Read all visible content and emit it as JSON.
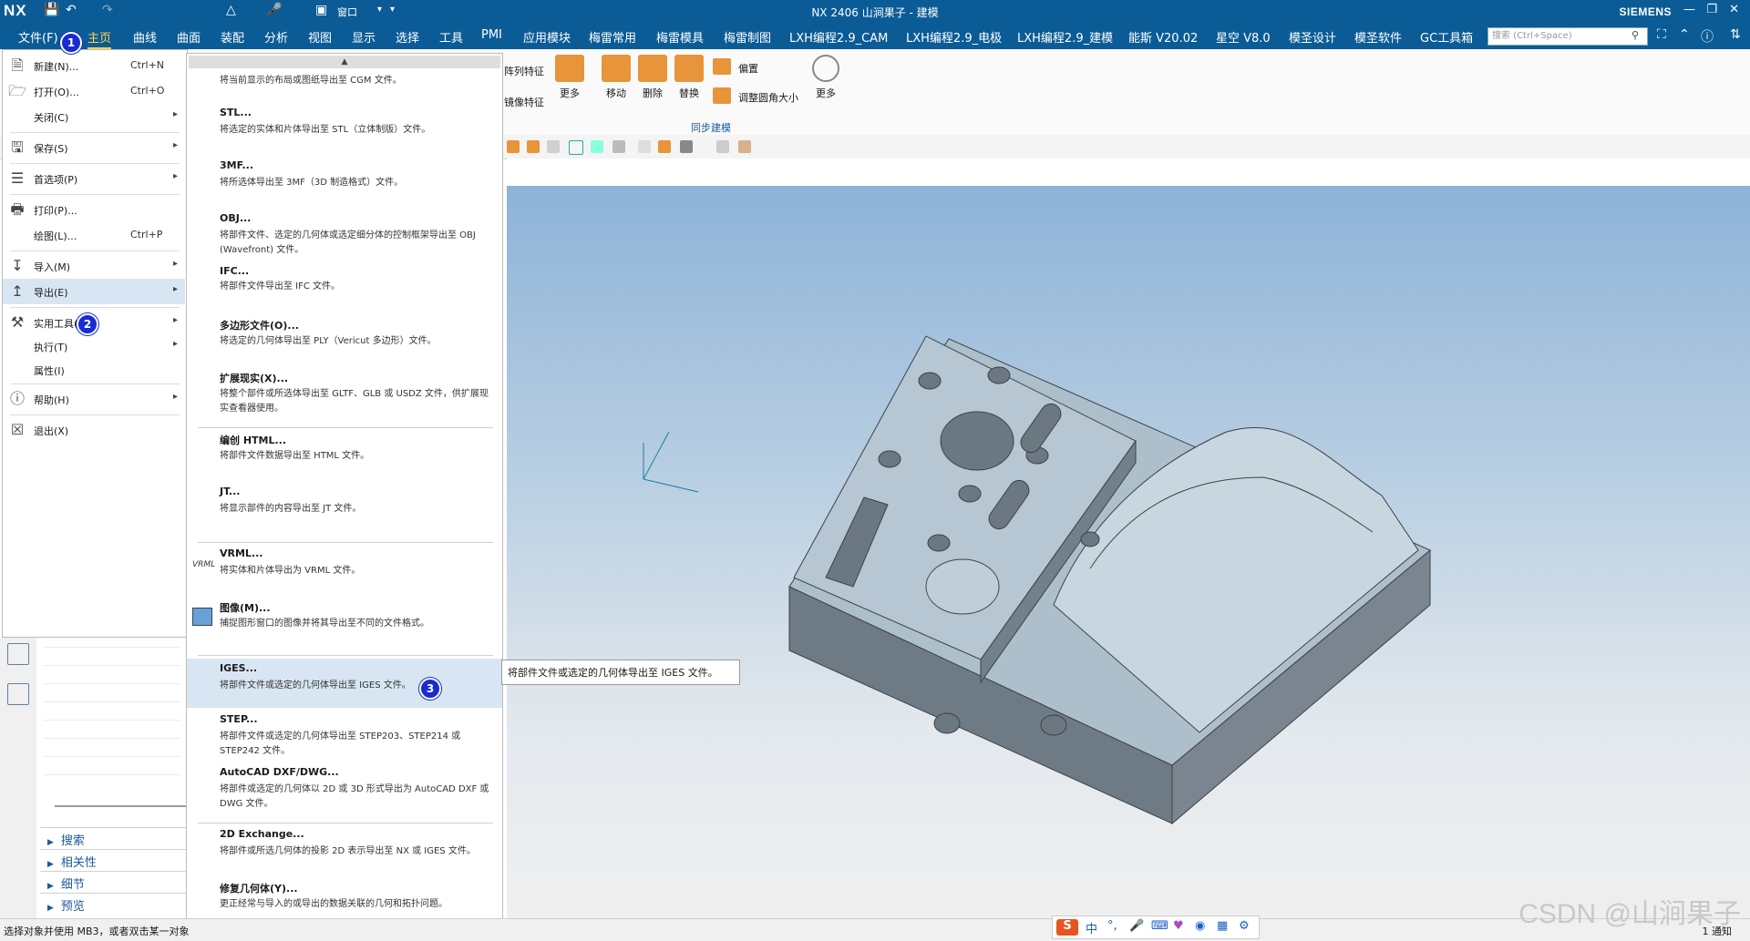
{
  "app": {
    "logo": "NX",
    "title": "NX 2406 山涧果子 - 建模",
    "brand": "SIEMENS",
    "window_menu": "窗口",
    "accent": "#0b5c96"
  },
  "tabs": [
    "文件(F)",
    "主页",
    "曲线",
    "曲面",
    "装配",
    "分析",
    "视图",
    "显示",
    "选择",
    "工具",
    "PMI",
    "应用模块",
    "梅雷常用",
    "梅雷模具",
    "梅雷制图",
    "LXH编程2.9_CAM",
    "LXH编程2.9_电极",
    "LXH编程2.9_建模",
    "能斯 V20.02",
    "星空 V8.0",
    "模圣设计",
    "模圣软件",
    "GC工具箱"
  ],
  "search": {
    "placeholder": "搜索 (Ctrl+Space)"
  },
  "ribbon": {
    "partial_top": "阵列特征",
    "partial_bottom": "镜像特征",
    "more1": "更多",
    "move": "移动",
    "delete": "删除",
    "replace": "替换",
    "offset": "偏置",
    "resize_blend": "调整圆角大小",
    "more2": "更多",
    "group_sync": "同步建模"
  },
  "file_menu": {
    "items": [
      {
        "label": "新建(N)...",
        "shortcut": "Ctrl+N",
        "icon": "new-file-icon"
      },
      {
        "label": "打开(O)...",
        "shortcut": "Ctrl+O",
        "icon": "open-folder-icon"
      },
      {
        "label": "关闭(C)",
        "arrow": true
      },
      {
        "label": "保存(S)",
        "arrow": true,
        "icon": "save-icon"
      },
      {
        "label": "首选项(P)",
        "arrow": true,
        "icon": "preferences-icon"
      },
      {
        "label": "打印(P)...",
        "icon": "print-icon"
      },
      {
        "label": "绘图(L)...",
        "shortcut": "Ctrl+P"
      },
      {
        "label": "导入(M)",
        "arrow": true,
        "icon": "import-icon"
      },
      {
        "label": "导出(E)",
        "arrow": true,
        "icon": "export-icon"
      },
      {
        "label": "实用工具(U)",
        "arrow": true,
        "icon": "tools-icon"
      },
      {
        "label": "执行(T)",
        "arrow": true
      },
      {
        "label": "属性(I)"
      },
      {
        "label": "帮助(H)",
        "arrow": true,
        "icon": "help-icon"
      },
      {
        "label": "退出(X)",
        "icon": "exit-icon"
      }
    ]
  },
  "export_menu": {
    "items": [
      {
        "title": "",
        "desc": "将当前显示的布局或图纸导出至 CGM 文件。"
      },
      {
        "title": "STL...",
        "desc": "将选定的实体和片体导出至 STL（立体制版）文件。"
      },
      {
        "title": "3MF...",
        "desc": "将所选体导出至 3MF（3D 制造格式）文件。"
      },
      {
        "title": "OBJ...",
        "desc": "将部件文件、选定的几何体或选定细分体的控制框架导出至 OBJ (Wavefront) 文件。"
      },
      {
        "title": "IFC...",
        "desc": "将部件文件导出至 IFC 文件。"
      },
      {
        "title": "多边形文件(O)...",
        "desc": "将选定的几何体导出至 PLY（Vericut 多边形）文件。"
      },
      {
        "title": "扩展现实(X)...",
        "desc": "将整个部件或所选体导出至 GLTF、GLB 或 USDZ 文件，供扩展现实查看器使用。"
      },
      {
        "title": "编创 HTML...",
        "desc": "将部件文件数据导出至 HTML 文件。"
      },
      {
        "title": "JT...",
        "desc": "将显示部件的内容导出至 JT 文件。"
      },
      {
        "title": "VRML...",
        "desc": "将实体和片体导出为 VRML 文件。"
      },
      {
        "title": "图像(M)...",
        "desc": "捕捉图形窗口的图像并将其导出至不同的文件格式。"
      },
      {
        "title": "IGES...",
        "desc": "将部件文件或选定的几何体导出至 IGES 文件。"
      },
      {
        "title": "STEP...",
        "desc": "将部件文件或选定的几何体导出至 STEP203、STEP214 或 STEP242 文件。"
      },
      {
        "title": "AutoCAD DXF/DWG...",
        "desc": "将部件或选定的几何体以 2D 或 3D 形式导出为 AutoCAD DXF 或 DWG 文件。"
      },
      {
        "title": "2D Exchange...",
        "desc": "将部件或所选几何体的投影 2D 表示导出至 NX 或 IGES 文件。"
      },
      {
        "title": "修复几何体(Y)...",
        "desc": "更正经常与导入的或导出的数据关联的几何和拓扑问题。"
      }
    ],
    "vrml_icon_text": "VRML"
  },
  "tooltip": "将部件文件或选定的几何体导出至 IGES 文件。",
  "badges": [
    "1",
    "2",
    "3"
  ],
  "navigator": {
    "sections": [
      "搜索",
      "相关性",
      "细节",
      "预览"
    ]
  },
  "status": {
    "prompt": "选择对象并使用 MB3，或者双击某一对象",
    "notify": "1 通知"
  },
  "ime": {
    "label": "中"
  },
  "watermark": "CSDN @山涧果子"
}
